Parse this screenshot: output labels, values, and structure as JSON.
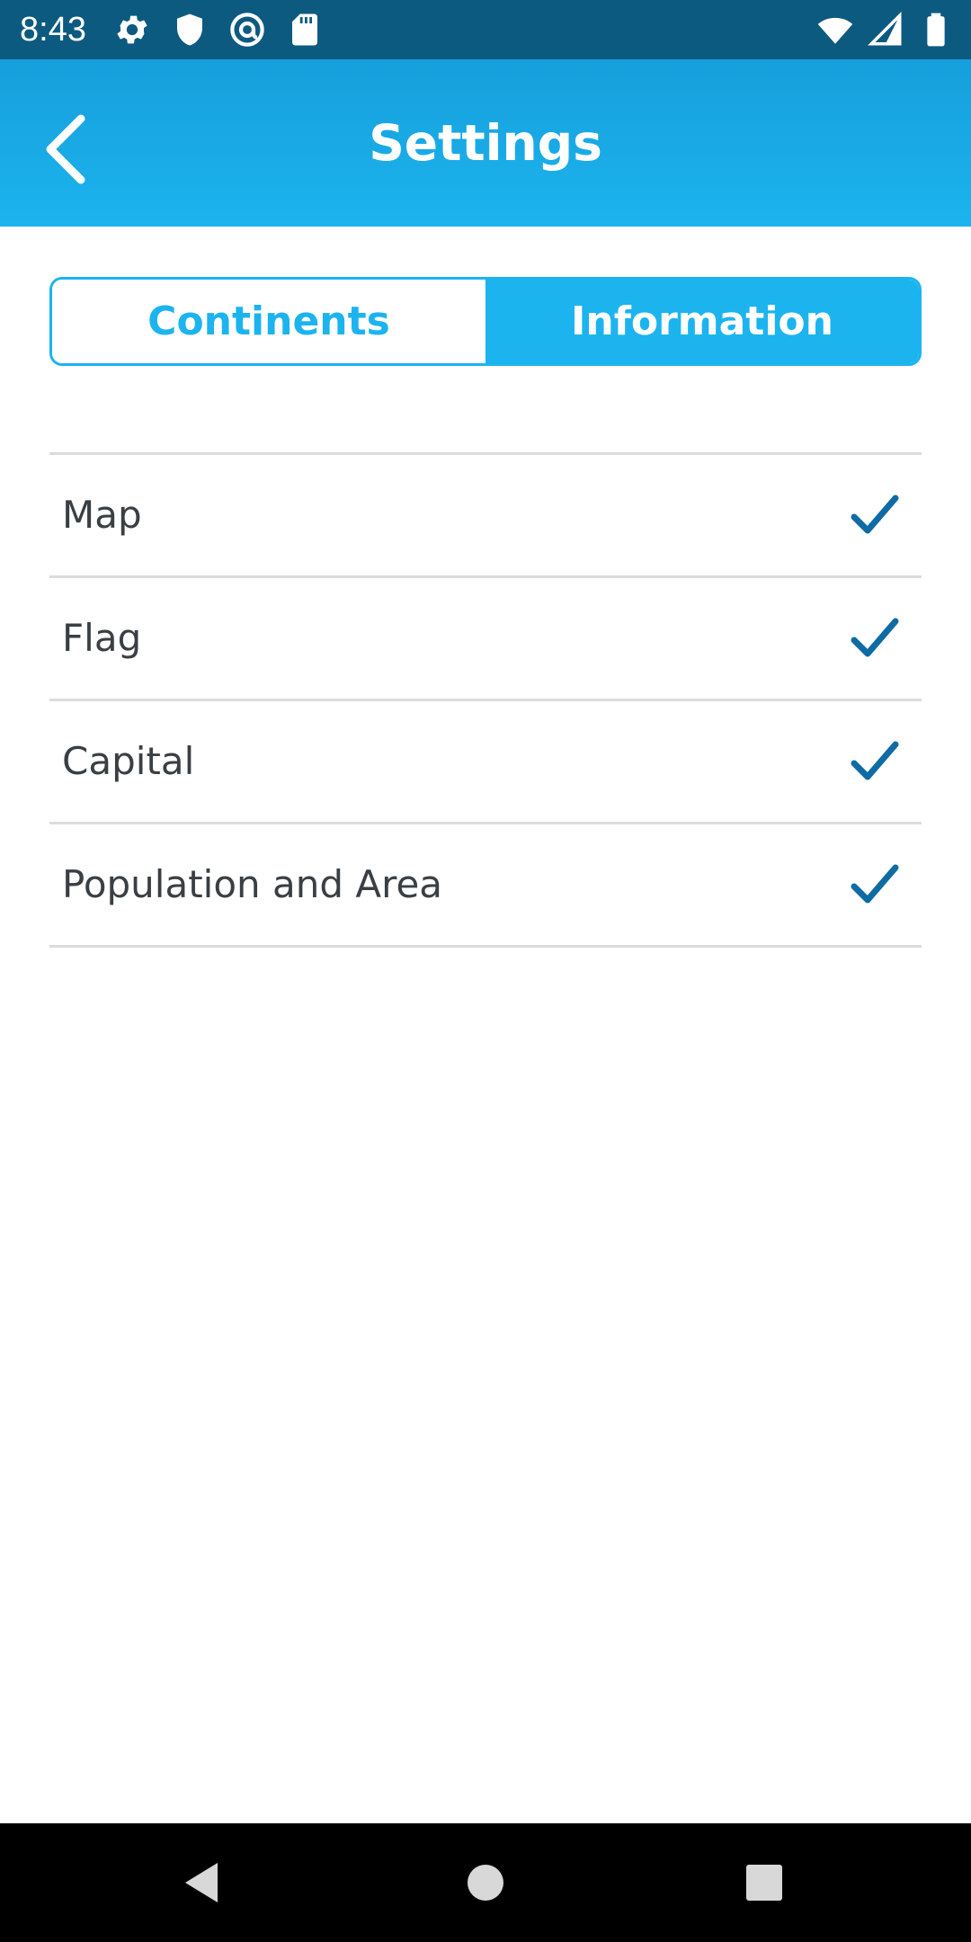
{
  "status_bar": {
    "time": "8:43",
    "left_icons": [
      "gear-icon",
      "shield-icon",
      "at-sign-icon",
      "sd-card-icon"
    ],
    "right_icons": [
      "wifi-icon",
      "cell-signal-icon",
      "battery-icon"
    ],
    "background": "#0d5a80"
  },
  "app_bar": {
    "title": "Settings",
    "back_icon": "chevron-left-icon",
    "background": "#1cb4ee"
  },
  "tabs": [
    {
      "label": "Continents",
      "selected": false
    },
    {
      "label": "Information",
      "selected": true
    }
  ],
  "options": [
    {
      "label": "Map",
      "checked": true
    },
    {
      "label": "Flag",
      "checked": true
    },
    {
      "label": "Capital",
      "checked": true
    },
    {
      "label": "Population and Area",
      "checked": true
    }
  ],
  "colors": {
    "accent": "#1cb4ee",
    "check": "#0f6ba3",
    "text": "#3a3f44",
    "divider": "#dcdcdc"
  },
  "nav_bar": {
    "buttons": [
      "back-triangle-icon",
      "home-circle-icon",
      "recents-square-icon"
    ]
  }
}
